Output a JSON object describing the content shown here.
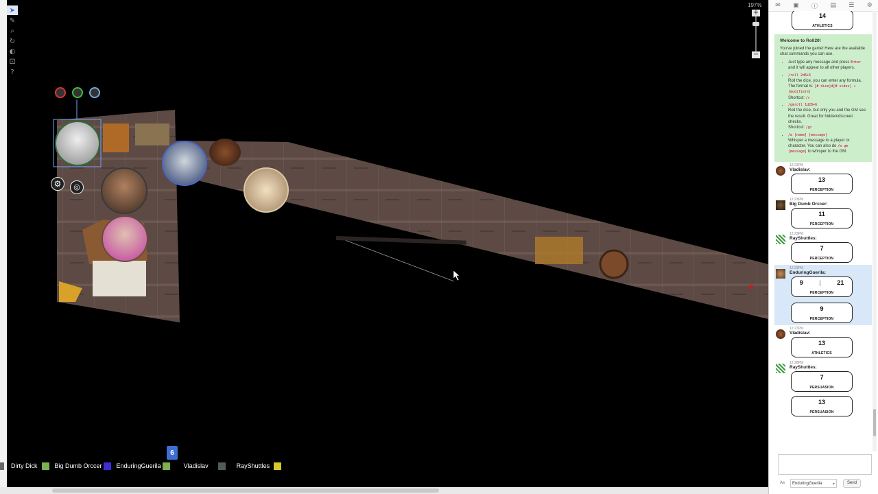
{
  "toolbar": {
    "tools": [
      "select-icon",
      "draw-icon",
      "zoom-icon",
      "measure-icon",
      "fog-icon",
      "dice-icon",
      "help-icon"
    ]
  },
  "zoom": {
    "label": "197%"
  },
  "panel": {
    "tabs": [
      "chat-icon",
      "art-icon",
      "journal-icon",
      "compendium-icon",
      "deck-icon",
      "settings-icon"
    ]
  },
  "chat": {
    "top_roll": {
      "value": "14",
      "skill": "ATHLETICS"
    },
    "welcome": {
      "title": "Welcome to Roll20!",
      "intro": "You've joined the game! Here are the available chat commands you can use.",
      "item1_text": "Just type any message and press",
      "item1_code": "Enter",
      "item1_tail": "and it will appear to all other players.",
      "item2_code": "/roll 2d6+5",
      "item2_text": "Roll the dice, you can enter any formula. The format is:",
      "item2_fmt": "[# dice]d[# sides] + [modifiers]",
      "item2_short": "Shortcut:",
      "item2_short_code": "/r",
      "item3_code": "/gmroll 1d20+6",
      "item3_text": "Roll the dice, but only you and the GM see the result. Great for hidden/discreet checks.",
      "item3_short": "Shortcut:",
      "item3_short_code": "/gr",
      "item4_code": "/w [name] [message]",
      "item4_text": "Whisper a message to a player or character. You can also do",
      "item4_code2": "/w gm [message]",
      "item4_tail": "to whisper to the GM."
    },
    "messages": [
      {
        "time": "12:23PM",
        "name": "Vladislav:",
        "value": "13",
        "skill": "PERCEPTION"
      },
      {
        "time": "12:23PM",
        "name": "Big Dumb Orccer:",
        "value": "11",
        "skill": "PERCEPTION"
      },
      {
        "time": "12:23PM",
        "name": "RayShuttles:",
        "value": "7",
        "skill": "PERCEPTION"
      },
      {
        "time": "12:23PM",
        "name": "EnduringGuerila:",
        "value_a": "9",
        "value_b": "21",
        "skill": "PERCEPTION",
        "value2": "9",
        "skill2": "PERCEPTION"
      },
      {
        "time": "12:27PM",
        "name": "Vladislav:",
        "value": "13",
        "skill": "ATHLETICS"
      },
      {
        "time": "12:28PM",
        "name": "RayShuttles:",
        "value": "7",
        "skill": "PERSUASION",
        "value2": "13",
        "skill2": "PERSUASION"
      }
    ],
    "as_label": "As",
    "as_value": "EnduringGuerila",
    "send_label": "Send"
  },
  "players": [
    {
      "name": "Dirty Dick",
      "color": "#7fae4f"
    },
    {
      "name": "Big Dumb Orccer",
      "color": "#3b2fd1"
    },
    {
      "name": "EnduringGuerila",
      "color": "#7fae4f"
    },
    {
      "name": "Vladislav",
      "color": "#4d5c5c"
    },
    {
      "name": "RayShuttles",
      "color": "#d6c72b"
    }
  ],
  "player_badge": "6"
}
